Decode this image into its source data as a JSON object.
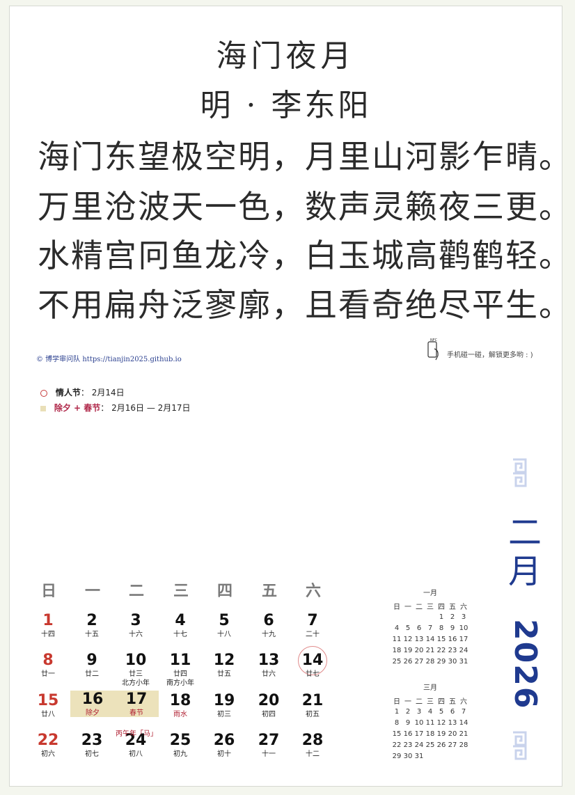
{
  "poem": {
    "title": "海门夜月",
    "author": "明 · 李东阳",
    "lines": [
      "海门东望极空明，月里山河影乍晴。",
      "万里沧波天一色，数声灵籁夜三更。",
      "水精宫冋鱼龙冷，白玉城高鹳鹤轻。",
      "不用扁舟泛寥廓，且看奇绝尽平生。"
    ]
  },
  "credit": {
    "text": "© 博学审问队 https://tianjin2025.github.io"
  },
  "nfc": {
    "icon": "nfc-phone-icon",
    "text": "手机碰一碰，解锁更多哟 : )"
  },
  "legend": [
    {
      "marker": "circle",
      "name": "情人节",
      "sep": "：",
      "value": "2月14日"
    },
    {
      "marker": "square",
      "name": "除夕 + 春节",
      "sep": "：",
      "value": "2月16日 — 2月17日"
    }
  ],
  "month_label": "二月",
  "year_label": "2026",
  "colors": {
    "accent_blue": "#1f3a8f",
    "holiday_red": "#c8392f",
    "festival_highlight": "#ece2bb"
  },
  "weekdays": [
    "日",
    "一",
    "二",
    "三",
    "四",
    "五",
    "六"
  ],
  "days": [
    {
      "d": "1",
      "l": "十四",
      "red": true
    },
    {
      "d": "2",
      "l": "十五"
    },
    {
      "d": "3",
      "l": "十六"
    },
    {
      "d": "4",
      "l": "十七"
    },
    {
      "d": "5",
      "l": "十八"
    },
    {
      "d": "6",
      "l": "十九"
    },
    {
      "d": "7",
      "l": "二十"
    },
    {
      "d": "8",
      "l": "廿一",
      "red": true
    },
    {
      "d": "9",
      "l": "廿二"
    },
    {
      "d": "10",
      "l": "廿三",
      "x": "北方小年"
    },
    {
      "d": "11",
      "l": "廿四",
      "x": "南方小年"
    },
    {
      "d": "12",
      "l": "廿五"
    },
    {
      "d": "13",
      "l": "廿六"
    },
    {
      "d": "14",
      "l": "廿七",
      "circle": true
    },
    {
      "d": "15",
      "l": "廿八",
      "red": true
    },
    {
      "d": "16",
      "l": "除夕",
      "hl": true,
      "fest": true
    },
    {
      "d": "17",
      "l": "春节",
      "hl": true,
      "fest": true
    },
    {
      "d": "18",
      "l": "雨水",
      "fest": true
    },
    {
      "d": "19",
      "l": "初三"
    },
    {
      "d": "20",
      "l": "初四"
    },
    {
      "d": "21",
      "l": "初五"
    },
    {
      "d": "22",
      "l": "初六",
      "red": true
    },
    {
      "d": "23",
      "l": "初七"
    },
    {
      "d": "24",
      "l": "初八"
    },
    {
      "d": "25",
      "l": "初九"
    },
    {
      "d": "26",
      "l": "初十"
    },
    {
      "d": "27",
      "l": "十一"
    },
    {
      "d": "28",
      "l": "十二"
    }
  ],
  "horse_year": "丙午年「马」",
  "mini_months": [
    {
      "title": "一月",
      "head": [
        "日",
        "一",
        "二",
        "三",
        "四",
        "五",
        "六"
      ],
      "rows": [
        [
          "",
          "",
          "",
          "",
          "1",
          "2",
          "3"
        ],
        [
          "4",
          "5",
          "6",
          "7",
          "8",
          "9",
          "10"
        ],
        [
          "11",
          "12",
          "13",
          "14",
          "15",
          "16",
          "17"
        ],
        [
          "18",
          "19",
          "20",
          "21",
          "22",
          "23",
          "24"
        ],
        [
          "25",
          "26",
          "27",
          "28",
          "29",
          "30",
          "31"
        ]
      ]
    },
    {
      "title": "三月",
      "head": [
        "日",
        "一",
        "二",
        "三",
        "四",
        "五",
        "六"
      ],
      "rows": [
        [
          "1",
          "2",
          "3",
          "4",
          "5",
          "6",
          "7"
        ],
        [
          "8",
          "9",
          "10",
          "11",
          "12",
          "13",
          "14"
        ],
        [
          "15",
          "16",
          "17",
          "18",
          "19",
          "20",
          "21"
        ],
        [
          "22",
          "23",
          "24",
          "25",
          "26",
          "27",
          "28"
        ],
        [
          "29",
          "30",
          "31",
          "",
          "",
          "",
          ""
        ]
      ]
    }
  ]
}
